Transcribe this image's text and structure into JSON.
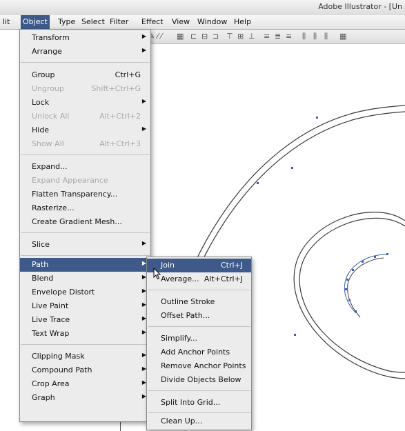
{
  "window": {
    "title": "Adobe Illustrator - [Un"
  },
  "menubar": {
    "items": [
      {
        "label": "lit",
        "active": false
      },
      {
        "label": "Object",
        "active": true
      },
      {
        "label": "Type",
        "active": false
      },
      {
        "label": "Select",
        "active": false
      },
      {
        "label": "Filter",
        "active": false
      },
      {
        "label": "Effect",
        "active": false
      },
      {
        "label": "View",
        "active": false
      },
      {
        "label": "Window",
        "active": false
      },
      {
        "label": "Help",
        "active": false
      }
    ]
  },
  "object_menu": {
    "transform": "Transform",
    "arrange": "Arrange",
    "group": "Group",
    "group_sc": "Ctrl+G",
    "ungroup": "Ungroup",
    "ungroup_sc": "Shift+Ctrl+G",
    "lock": "Lock",
    "unlock_all": "Unlock All",
    "unlock_all_sc": "Alt+Ctrl+2",
    "hide": "Hide",
    "show_all": "Show All",
    "show_all_sc": "Alt+Ctrl+3",
    "expand": "Expand...",
    "expand_appearance": "Expand Appearance",
    "flatten_transparency": "Flatten Transparency...",
    "rasterize": "Rasterize...",
    "create_gradient_mesh": "Create Gradient Mesh...",
    "slice": "Slice",
    "path": "Path",
    "blend": "Blend",
    "envelope_distort": "Envelope Distort",
    "live_paint": "Live Paint",
    "live_trace": "Live Trace",
    "text_wrap": "Text Wrap",
    "clipping_mask": "Clipping Mask",
    "compound_path": "Compound Path",
    "crop_area": "Crop Area",
    "graph": "Graph"
  },
  "path_menu": {
    "join": "Join",
    "join_sc": "Ctrl+J",
    "average": "Average...",
    "average_sc": "Alt+Ctrl+J",
    "outline_stroke": "Outline Stroke",
    "offset_path": "Offset Path...",
    "simplify": "Simplify...",
    "add_anchor_points": "Add Anchor Points",
    "remove_anchor_points": "Remove Anchor Points",
    "divide_objects_below": "Divide Objects Below",
    "split_into_grid": "Split Into Grid...",
    "clean_up": "Clean Up..."
  },
  "colors": {
    "highlight": "#3d5a8a",
    "menu_bg": "#ececec",
    "disabled_text": "#a9a9a9",
    "path_stroke": "#3a3a3a",
    "anchor": "#3b5fb5"
  },
  "icons": {
    "submenu_arrow": "triangle-right-icon",
    "cursor": "arrow-cursor-icon"
  }
}
